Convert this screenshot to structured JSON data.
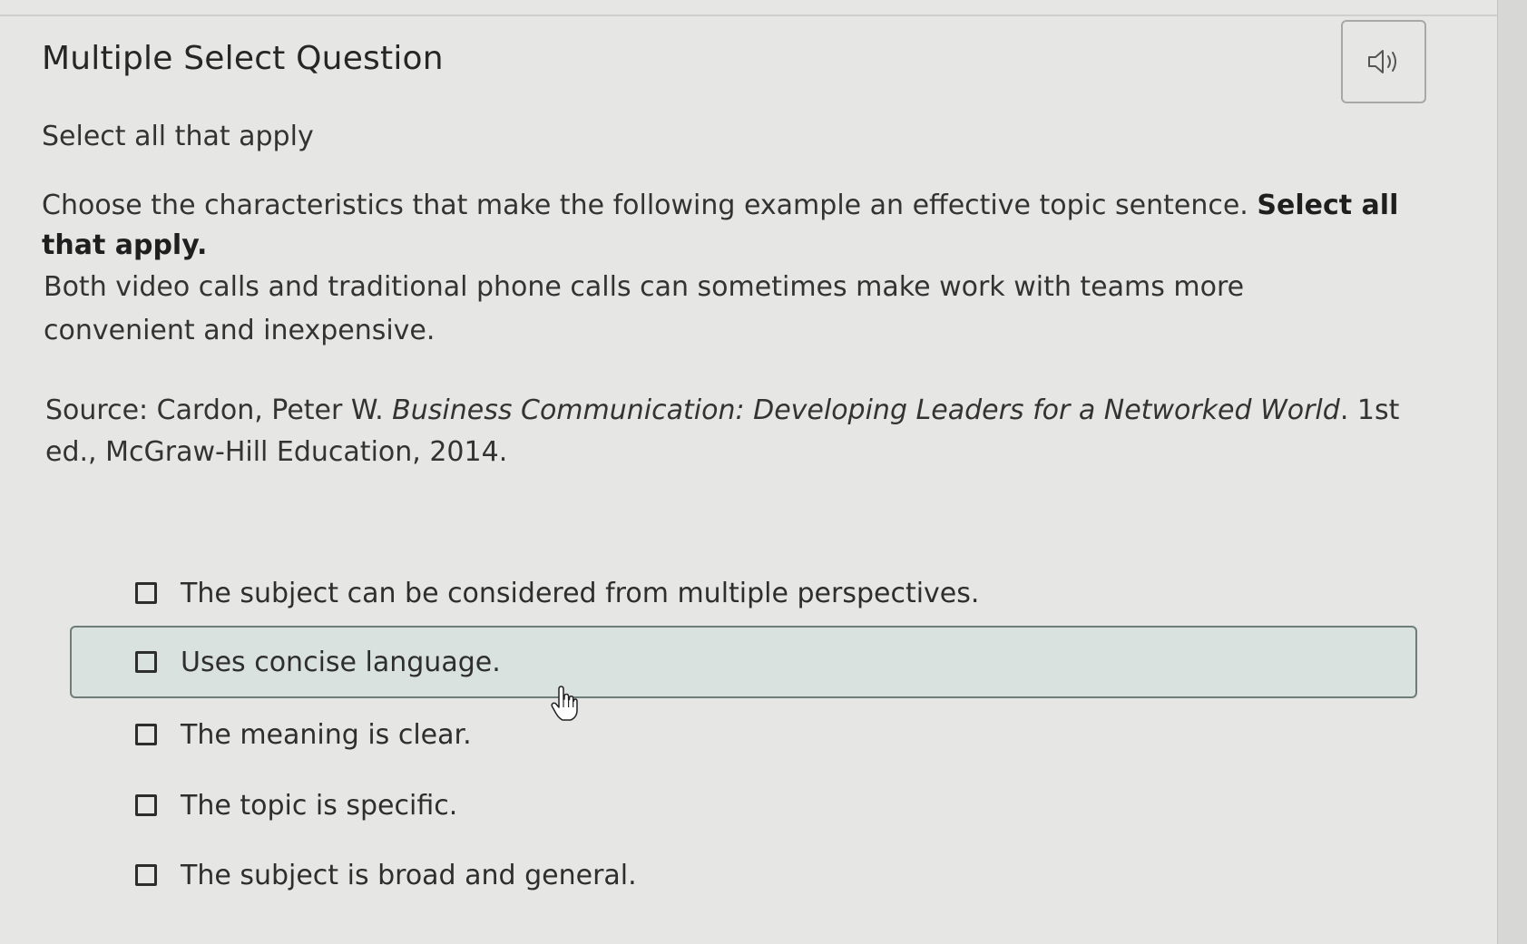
{
  "question": {
    "title": "Multiple Select Question",
    "instruction": "Select all that apply",
    "prompt_text": "Choose the characteristics that make the following example an effective topic sentence. ",
    "prompt_bold": "Select all that apply.",
    "example": "Both video calls and traditional phone calls can sometimes make work with teams more convenient and inexpensive.",
    "source_prefix": "Source: Cardon, Peter W. ",
    "source_title": "Business Communication: Developing Leaders for a Networked World",
    "source_suffix": ". 1st ed., McGraw-Hill Education, 2014."
  },
  "audio_button": {
    "icon": "speaker-icon"
  },
  "options": [
    {
      "label": "The subject can be considered from multiple perspectives.",
      "checked": false
    },
    {
      "label": "Uses concise language.",
      "checked": false,
      "hovered": true
    },
    {
      "label": "The meaning is clear.",
      "checked": false
    },
    {
      "label": "The topic is specific.",
      "checked": false
    },
    {
      "label": "The subject is broad and general.",
      "checked": false
    }
  ],
  "colors": {
    "background": "#e6e6e4",
    "hover_fill": "#d9e2df",
    "hover_border": "#6f7d7a",
    "text": "#2e2e2e"
  }
}
